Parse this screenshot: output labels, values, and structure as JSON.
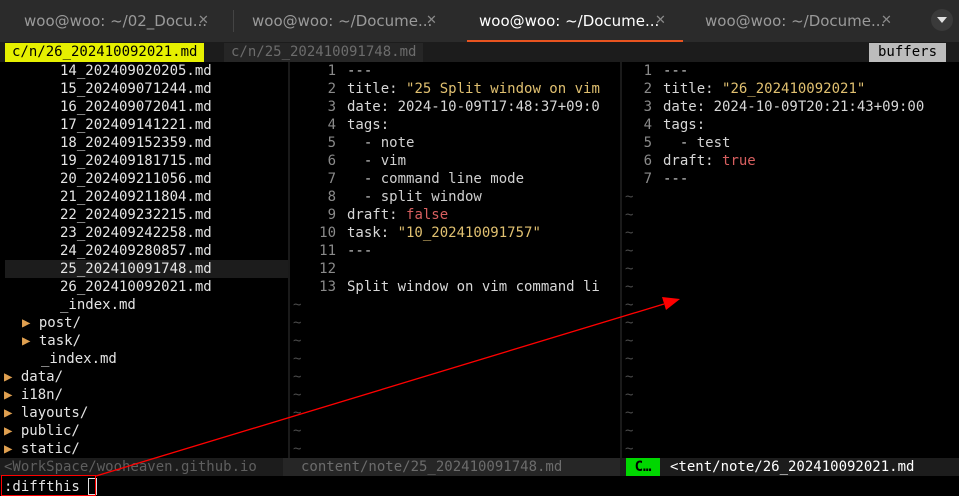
{
  "tabs": [
    {
      "label": "woo@woo: ~/02_Docu..."
    },
    {
      "label": "woo@woo: ~/Docume..."
    },
    {
      "label": "woo@woo: ~/Docume..."
    },
    {
      "label": "woo@woo: ~/Docume..."
    }
  ],
  "buffer_line": {
    "active_buffer": "c/n/26_202410092021.md",
    "inactive_buffer": "c/n/25_202410091748.md",
    "buffers_label": "buffers"
  },
  "file_tree": {
    "files": [
      "14_202409020205.md",
      "15_202409071244.md",
      "16_202409072041.md",
      "17_202409141221.md",
      "18_202409152359.md",
      "19_202409181715.md",
      "20_202409211056.md",
      "21_202409211804.md",
      "22_202409232215.md",
      "23_202409242258.md",
      "24_202409280857.md",
      "25_202410091748.md",
      "26_202410092021.md"
    ],
    "index_file": "_index.md",
    "subfolders": [
      "post/",
      "task/"
    ],
    "content_index": "_index.md",
    "top_folders": [
      "data/",
      "i18n/",
      "layouts/",
      "public/",
      "static/"
    ],
    "arrow_closed": "▶",
    "highlighted_index": 11
  },
  "left_pane": {
    "lines": [
      {
        "n": "1",
        "parts": [
          [
            "dash",
            "---"
          ]
        ]
      },
      {
        "n": "2",
        "parts": [
          [
            "key",
            "title: "
          ],
          [
            "str",
            "\"25 Split window on vim"
          ]
        ]
      },
      {
        "n": "3",
        "parts": [
          [
            "key",
            "date: 2024-10-09T17:48:37+09:0"
          ]
        ]
      },
      {
        "n": "4",
        "parts": [
          [
            "key",
            "tags:"
          ]
        ]
      },
      {
        "n": "5",
        "parts": [
          [
            "dash",
            "  - note"
          ]
        ]
      },
      {
        "n": "6",
        "parts": [
          [
            "dash",
            "  - vim"
          ]
        ]
      },
      {
        "n": "7",
        "parts": [
          [
            "dash",
            "  - command line mode"
          ]
        ]
      },
      {
        "n": "8",
        "parts": [
          [
            "dash",
            "  - split window"
          ]
        ]
      },
      {
        "n": "9",
        "parts": [
          [
            "key",
            "draft: "
          ],
          [
            "bool",
            "false"
          ]
        ]
      },
      {
        "n": "10",
        "parts": [
          [
            "key",
            "task: "
          ],
          [
            "str",
            "\"10_202410091757\""
          ]
        ]
      },
      {
        "n": "11",
        "parts": [
          [
            "dash",
            "---"
          ]
        ]
      },
      {
        "n": "12",
        "parts": []
      },
      {
        "n": "13",
        "parts": [
          [
            "key",
            "Split window on vim command li"
          ]
        ]
      }
    ]
  },
  "right_pane": {
    "lines": [
      {
        "n": "1",
        "parts": [
          [
            "dash",
            "---"
          ]
        ]
      },
      {
        "n": "2",
        "parts": [
          [
            "key",
            "title: "
          ],
          [
            "str",
            "\"26_202410092021\""
          ]
        ]
      },
      {
        "n": "3",
        "parts": [
          [
            "key",
            "date: 2024-10-09T20:21:43+09:00"
          ]
        ]
      },
      {
        "n": "4",
        "parts": [
          [
            "key",
            "tags:"
          ]
        ]
      },
      {
        "n": "5",
        "parts": [
          [
            "dash",
            "  - test"
          ]
        ]
      },
      {
        "n": "6",
        "parts": [
          [
            "key",
            "draft: "
          ],
          [
            "bool",
            "true"
          ]
        ]
      },
      {
        "n": "7",
        "parts": [
          [
            "dash",
            "---"
          ]
        ]
      }
    ]
  },
  "tilde": "~",
  "statusline": {
    "left": "<WorkSpace/wooheaven.github.io",
    "middle": "content/note/25_202410091748.md",
    "mode": "C…",
    "right": "<tent/note/26_202410092021.md"
  },
  "command_line": {
    "text": ":diffthis"
  },
  "colors": {
    "accent_tab": "#e95420",
    "buffer_active_bg": "#e6f000",
    "mode_bg": "#00d700",
    "annotation": "#ff0000"
  }
}
